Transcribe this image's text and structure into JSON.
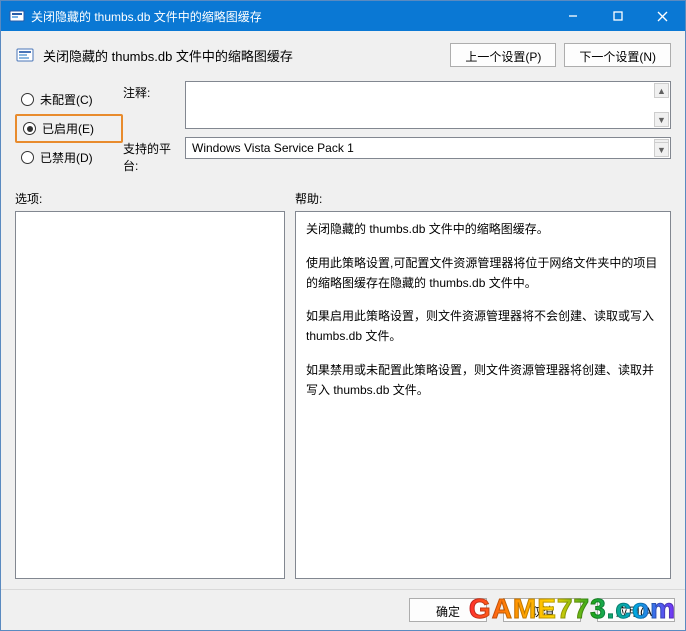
{
  "titlebar": {
    "title": "关闭隐藏的 thumbs.db 文件中的缩略图缓存"
  },
  "header": {
    "title": "关闭隐藏的 thumbs.db 文件中的缩略图缓存",
    "prev_button": "上一个设置(P)",
    "next_button": "下一个设置(N)"
  },
  "radios": {
    "not_configured": "未配置(C)",
    "enabled": "已启用(E)",
    "disabled": "已禁用(D)",
    "selected": "enabled"
  },
  "fields": {
    "comment_label": "注释:",
    "comment_value": "",
    "platform_label": "支持的平台:",
    "platform_value": "Windows Vista Service Pack 1"
  },
  "section_labels": {
    "options": "选项:",
    "help": "帮助:"
  },
  "help_paragraphs": [
    "关闭隐藏的 thumbs.db 文件中的缩略图缓存。",
    "使用此策略设置,可配置文件资源管理器将位于网络文件夹中的项目的缩略图缓存在隐藏的 thumbs.db 文件中。",
    "如果启用此策略设置，则文件资源管理器将不会创建、读取或写入 thumbs.db 文件。",
    "如果禁用或未配置此策略设置，则文件资源管理器将创建、读取并写入 thumbs.db 文件。"
  ],
  "footer": {
    "ok": "确定",
    "cancel": "取消",
    "apply": "应用(A)"
  },
  "watermark": "GAME773.com"
}
